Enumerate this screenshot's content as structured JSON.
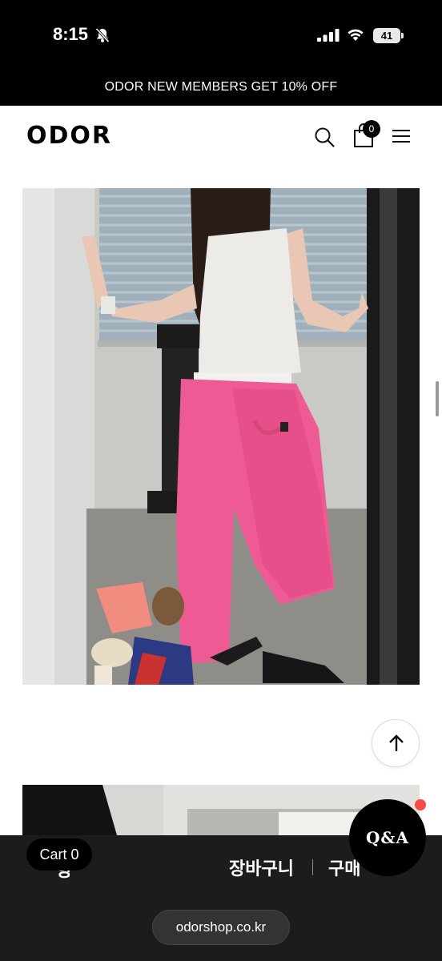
{
  "status_bar": {
    "time": "8:15",
    "battery": "41",
    "icons": [
      "bell-muted-icon",
      "signal-icon",
      "wifi-icon",
      "battery-icon"
    ]
  },
  "promo": {
    "text": "ODOR NEW MEMBERS GET 10% OFF"
  },
  "header": {
    "logo": "ODOR",
    "cart_count": "0",
    "icons": [
      "search-icon",
      "shopping-bag-icon",
      "hamburger-menu-icon"
    ]
  },
  "product": {
    "images": [
      "product-photo-pink-sweatpants",
      "product-photo-2"
    ]
  },
  "floating": {
    "scroll_top_icon": "arrow-up-icon",
    "qa_label": "Q&A",
    "cart_pill": "Cart 0"
  },
  "bottom_bar": {
    "left_label_partial": "항",
    "cart_label": "장바구니",
    "buy_label": "구매"
  },
  "browser": {
    "url": "odorshop.co.kr"
  },
  "colors": {
    "bar_black": "#000000",
    "bottom_bar": "#1c1c1c",
    "pants_pink": "#ee5a94",
    "notify_red": "#f44a4a"
  }
}
